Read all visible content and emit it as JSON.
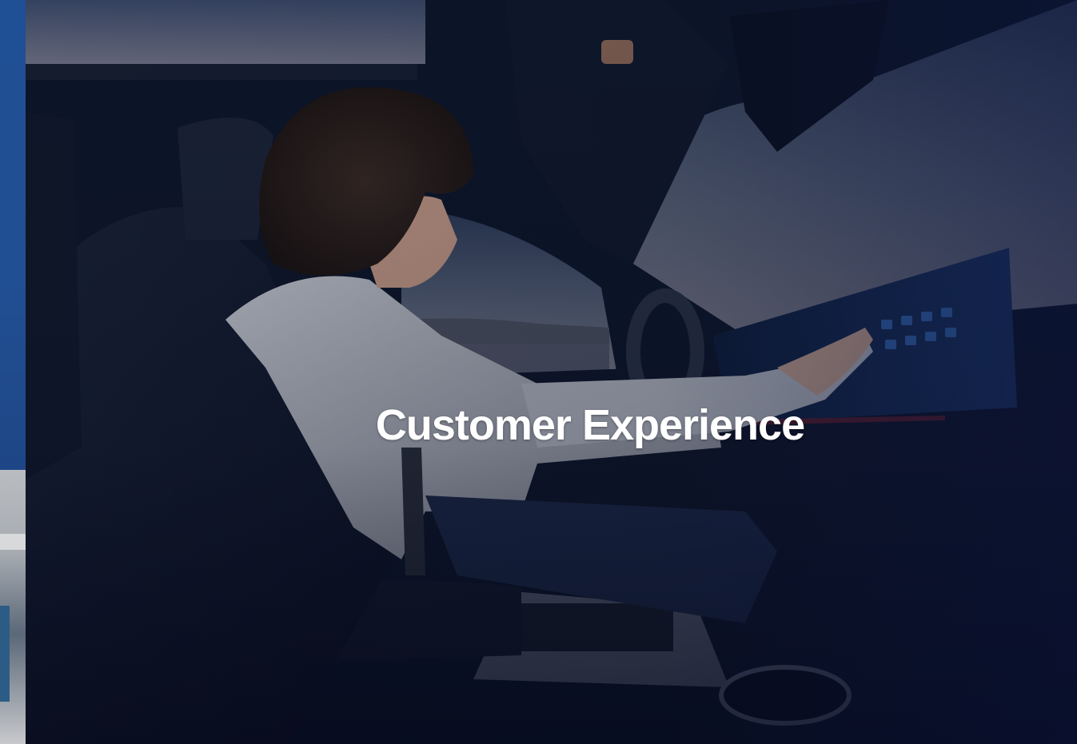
{
  "hero": {
    "title": "Customer Experience"
  },
  "colors": {
    "overlay_navy": "#0a1630",
    "prev_slide_blue": "#1f4f95",
    "title_text": "#ffffff"
  }
}
